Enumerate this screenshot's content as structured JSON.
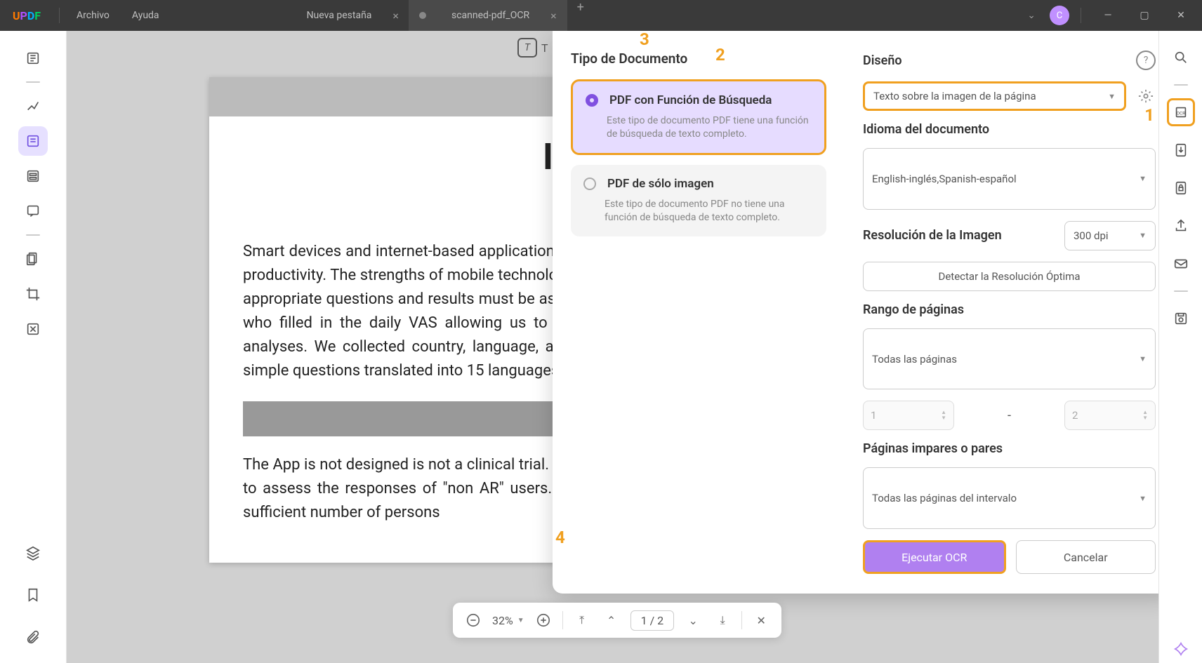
{
  "menu": {
    "archivo": "Archivo",
    "ayuda": "Ayuda"
  },
  "tabs": {
    "t0": "Nueva pestaña",
    "t1": "scanned-pdf_OCR"
  },
  "avatar_letter": "C",
  "doc": {
    "title": "Improve V\nin",
    "p1": "Smart devices and internet-based applications are already used in rhinitis (24-26) but none have assessed work productivity. The strengths of mobile technology include its widespread use and easy use, but there is a need for appropriate questions and results must be assessed by pilot studies. This pilot study was based on 1,136 users who filled in the daily VAS allowing us to perform comparisons on outcomes, but not to make subgroup analyses. We collected country, language, and the date of entry of information with the App. We used very simple questions translated into 15 languages.",
    "p2": "The App is not designed                                          is not a clinical trial. Thus, as expected, over 98% users reported \"AR\" and we are unable to assess the responses of \"non AR\" users. On the other hand, there are many days with no symptoms in a sufficient number of persons"
  },
  "top_tool_label": "T",
  "panel": {
    "doc_type_title": "Tipo de Documento",
    "opt1_title": "PDF con Función de Búsqueda",
    "opt1_desc": "Este tipo de documento PDF tiene una función de búsqueda de texto completo.",
    "opt2_title": "PDF de sólo imagen",
    "opt2_desc": "Este tipo de documento PDF no tiene una función de búsqueda de texto completo.",
    "diseno": "Diseño",
    "diseno_val": "Texto sobre la imagen de la página",
    "lang_label": "Idioma del documento",
    "lang_val": "English-inglés,Spanish-español",
    "res_label": "Resolución de la Imagen",
    "res_val": "300 dpi",
    "detect_btn": "Detectar la Resolución Óptima",
    "range_label": "Rango de páginas",
    "range_val": "Todas las páginas",
    "from": "1",
    "to": "2",
    "oddeven_label": "Páginas impares o pares",
    "oddeven_val": "Todas las páginas del intervalo",
    "run": "Ejecutar OCR",
    "cancel": "Cancelar"
  },
  "annots": {
    "a1": "1",
    "a2": "2",
    "a3": "3",
    "a4": "4"
  },
  "status": {
    "zoom": "32%",
    "page": "1",
    "total": "2"
  }
}
